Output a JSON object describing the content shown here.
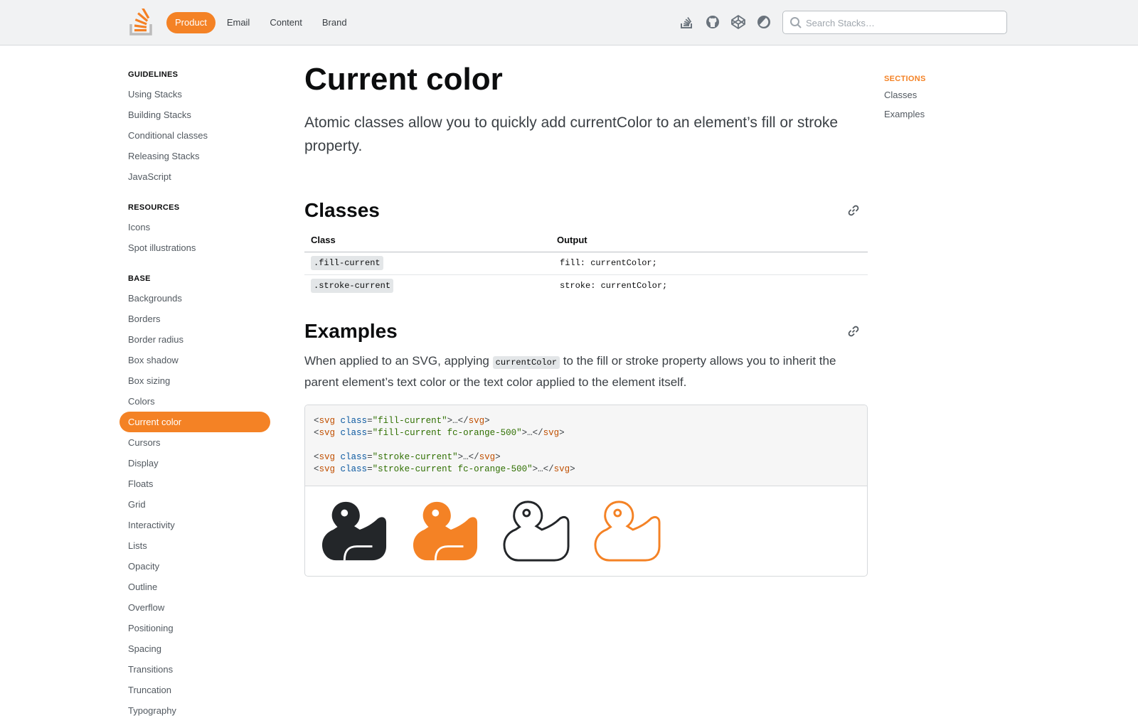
{
  "header": {
    "nav": [
      {
        "label": "Product",
        "active": true
      },
      {
        "label": "Email",
        "active": false
      },
      {
        "label": "Content",
        "active": false
      },
      {
        "label": "Brand",
        "active": false
      }
    ],
    "icons": [
      "stack-overflow-icon",
      "github-icon",
      "codepen-icon",
      "theme-toggle-icon"
    ],
    "search": {
      "placeholder": "Search Stacks…",
      "value": ""
    }
  },
  "sidebar": {
    "groups": [
      {
        "heading": "GUIDELINES",
        "items": [
          "Using Stacks",
          "Building Stacks",
          "Conditional classes",
          "Releasing Stacks",
          "JavaScript"
        ]
      },
      {
        "heading": "RESOURCES",
        "items": [
          "Icons",
          "Spot illustrations"
        ]
      },
      {
        "heading": "BASE",
        "items": [
          "Backgrounds",
          "Borders",
          "Border radius",
          "Box shadow",
          "Box sizing",
          "Colors",
          "Current color",
          "Cursors",
          "Display",
          "Floats",
          "Grid",
          "Interactivity",
          "Lists",
          "Opacity",
          "Outline",
          "Overflow",
          "Positioning",
          "Spacing",
          "Transitions",
          "Truncation",
          "Typography"
        ]
      }
    ],
    "active_item": "Current color"
  },
  "main": {
    "title": "Current color",
    "lede": "Atomic classes allow you to quickly add currentColor to an element’s fill or stroke property.",
    "classes": {
      "heading": "Classes",
      "columns": [
        "Class",
        "Output"
      ],
      "rows": [
        {
          "class": ".fill-current",
          "output": "fill: currentColor;"
        },
        {
          "class": ".stroke-current",
          "output": "stroke: currentColor;"
        }
      ]
    },
    "examples": {
      "heading": "Examples",
      "text_before": "When applied to an SVG, applying ",
      "inline_code": "currentColor",
      "text_after": " to the fill or stroke property allows you to inherit the parent element’s text color or the text color applied to the element itself.",
      "code": {
        "tag": "svg",
        "attr": "class",
        "ellipsis": "…",
        "lines": [
          "fill-current",
          "fill-current fc-orange-500",
          "",
          "stroke-current",
          "stroke-current fc-orange-500"
        ]
      },
      "duck_colors": [
        "#232629",
        "#f48225",
        "#232629",
        "#f48225"
      ]
    }
  },
  "toc": {
    "heading": "SECTIONS",
    "items": [
      "Classes",
      "Examples"
    ]
  },
  "colors": {
    "accent": "#f48225",
    "text": "#232629",
    "topbar": "#f1f2f3"
  }
}
